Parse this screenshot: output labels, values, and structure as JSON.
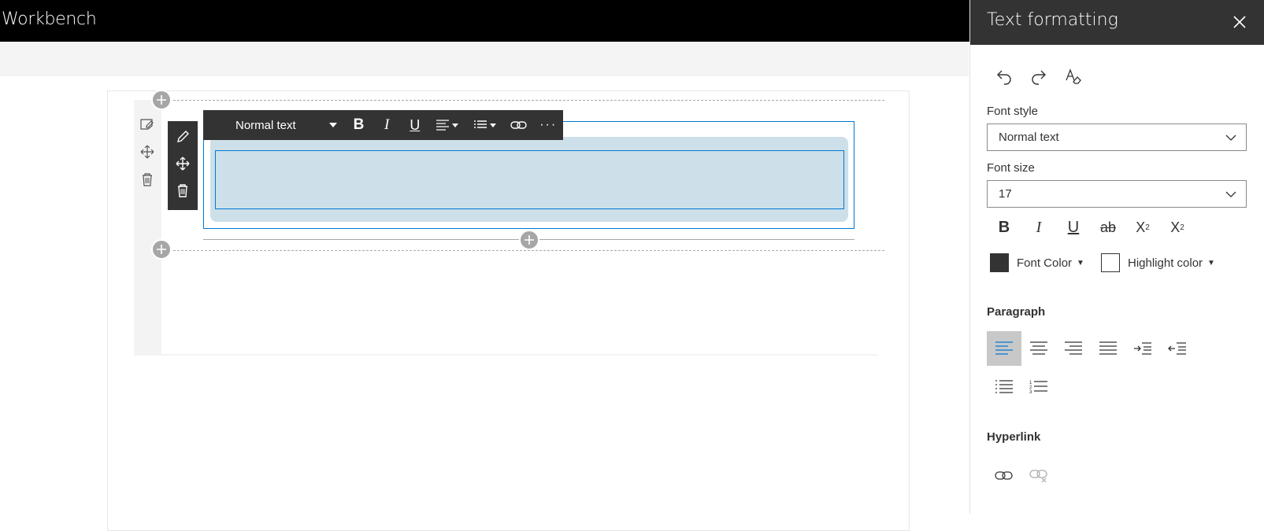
{
  "app": {
    "title": "Workbench"
  },
  "editor": {
    "toolbar": {
      "style_label": "Normal text",
      "icons": [
        "caret-down-icon",
        "bold-icon",
        "italic-icon",
        "underline-icon",
        "align-icon",
        "list-icon",
        "link-icon",
        "more-icon"
      ]
    },
    "webpart_toolbar": {
      "icons": [
        "edit-icon",
        "move-icon",
        "delete-icon"
      ]
    },
    "section_toolbar": {
      "icons": [
        "edit-section-icon",
        "move-section-icon",
        "delete-section-icon"
      ]
    }
  },
  "panel": {
    "title": "Text formatting",
    "font_style_label": "Font style",
    "font_style_value": "Normal text",
    "font_size_label": "Font size",
    "font_size_value": "17",
    "font_color_label": "Font Color",
    "highlight_color_label": "Highlight color",
    "font_color_swatch": "#333333",
    "highlight_color_swatch": "#ffffff",
    "paragraph_label": "Paragraph",
    "hyperlink_label": "Hyperlink"
  },
  "colors": {
    "accent": "#0078d4",
    "topbar": "#000000",
    "panel_header": "#333333",
    "selection_fill": "#cde0e9"
  }
}
